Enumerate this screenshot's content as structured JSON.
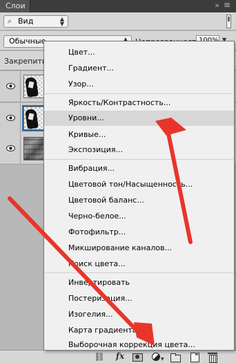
{
  "panel": {
    "tab_title": "Слои",
    "collapse_glyph": "»",
    "close_glyph": "≡"
  },
  "toolbar": {
    "filter_value": "Вид",
    "search_glyph": "⌕"
  },
  "blend": {
    "mode_value": "Обычные",
    "opacity_label": "Непрозрачность:",
    "opacity_value": "100%"
  },
  "lock": {
    "label": "Закрепить:"
  },
  "layers": [
    {
      "kind": "hand-on-transparent",
      "visible": true,
      "selected": false
    },
    {
      "kind": "hand-on-transparent",
      "visible": true,
      "selected": true
    },
    {
      "kind": "wall-texture",
      "visible": true,
      "selected": false
    }
  ],
  "menu": {
    "items": [
      "Цвет...",
      "Градиент...",
      "Узор...",
      "Яркость/Контрастность...",
      "Уровни...",
      "Кривые...",
      "Экспозиция...",
      "Вибрация...",
      "Цветовой тон/Насыщенность...",
      "Цветовой баланс...",
      "Черно-белое...",
      "Фотофильтр...",
      "Микширование каналов...",
      "Поиск цвета...",
      "Инвертировать",
      "Постеризация...",
      "Изогелия...",
      "Карта градиента...",
      "Выборочная коррекция цвета..."
    ],
    "highlighted": "Уровни..."
  },
  "bottom_bar": {
    "fx_label": "fx",
    "link_glyph": "⛓"
  },
  "colors": {
    "annotation_arrow": "#e8352a",
    "menu_highlight": "#d7d7d7",
    "panel_bg": "#d6d6d6"
  }
}
